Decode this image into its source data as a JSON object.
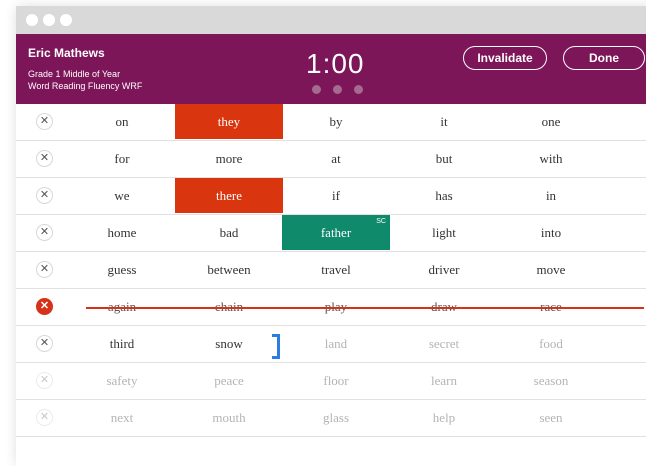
{
  "header": {
    "student_name": "Eric Mathews",
    "grade_line": "Grade 1   Middle of Year",
    "assessment_line": "Word Reading Fluency   WRF",
    "timer": "1:00",
    "invalidate_label": "Invalidate",
    "done_label": "Done"
  },
  "rows": [
    {
      "words": [
        "on",
        "they",
        "by",
        "it",
        "one"
      ]
    },
    {
      "words": [
        "for",
        "more",
        "at",
        "but",
        "with"
      ]
    },
    {
      "words": [
        "we",
        "there",
        "if",
        "has",
        "in"
      ]
    },
    {
      "words": [
        "home",
        "bad",
        "father",
        "light",
        "into"
      ]
    },
    {
      "words": [
        "guess",
        "between",
        "travel",
        "driver",
        "move"
      ]
    },
    {
      "words": [
        "again",
        "chain",
        "play",
        "draw",
        "race"
      ]
    },
    {
      "words": [
        "third",
        "snow",
        "land",
        "secret",
        "food"
      ]
    },
    {
      "words": [
        "safety",
        "peace",
        "floor",
        "learn",
        "season"
      ]
    },
    {
      "words": [
        "next",
        "mouth",
        "glass",
        "help",
        "seen"
      ]
    }
  ],
  "self_correction_tag": "SC",
  "colors": {
    "header_bg": "#7d1559",
    "error": "#d9360f",
    "self_correct": "#0f8a6b",
    "bracket": "#2a7de1"
  }
}
